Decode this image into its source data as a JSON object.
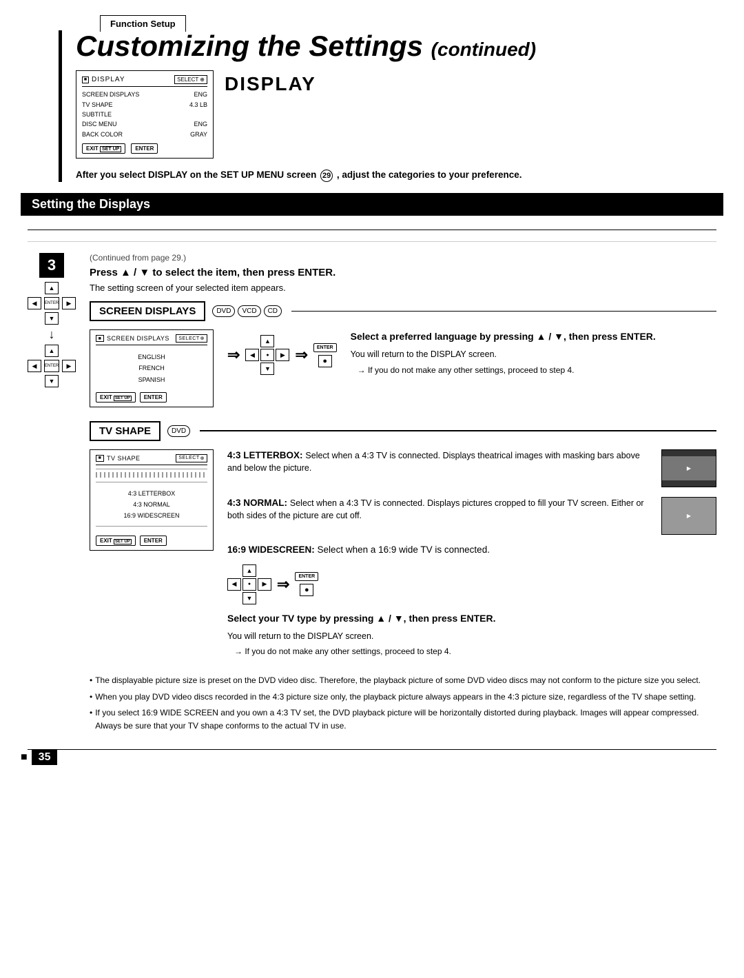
{
  "functionSetup": {
    "tab": "Function Setup"
  },
  "title": {
    "main": "Customizing the Settings",
    "continued": "(continued)"
  },
  "displayMenu": {
    "icon": "■",
    "label": "DISPLAY",
    "selectLabel": "SELECT",
    "rows": [
      {
        "left": "SCREEN DISPLAYS",
        "right": "ENG"
      },
      {
        "left": "TV SHAPE",
        "right": "4.3 LB"
      },
      {
        "left": "SUBTITLE",
        "right": ""
      },
      {
        "left": "DISC MENU",
        "right": "ENG"
      },
      {
        "left": "BACK COLOR",
        "right": "GRAY"
      }
    ],
    "exitBtn": "EXIT",
    "setupBtn": "SET UP",
    "enterBtn": "ENTER"
  },
  "displayHeading": "DISPLAY",
  "afterText": "After you select DISPLAY on the SET UP MENU screen",
  "screenNum": "29",
  "afterText2": ", adjust the categories to your preference.",
  "sectionHeader": "Setting the Displays",
  "step": {
    "number": "3",
    "continuedNote": "(Continued from page 29.)",
    "pressInstruction": "Press ▲ / ▼ to select the item, then press ENTER.",
    "settingScreenText": "The setting screen of your selected item appears."
  },
  "screenDisplays": {
    "title": "SCREEN DISPLAYS",
    "discBadges": [
      "DVD",
      "VCD",
      "CD"
    ],
    "menuItems": [
      "ENGLISH",
      "FRENCH",
      "SPANISH"
    ],
    "rightHeading": "Select a preferred language by pressing ▲ / ▼, then press ENTER.",
    "returnText": "You will return to the DISPLAY screen.",
    "proceedNote": "→ If you do not make any other settings, proceed to step 4."
  },
  "tvShape": {
    "title": "TV SHAPE",
    "discBadge": "DVD",
    "menuItems": [
      "4:3 LETTERBOX",
      "4:3 NORMAL",
      "16:9 WIDESCREEN"
    ],
    "options": [
      {
        "label": "4:3 LETTERBOX:",
        "desc": "Select when a 4:3 TV is connected. Displays theatrical images with masking bars above and below the picture.",
        "imgType": "letterbox"
      },
      {
        "label": "4:3 NORMAL:",
        "desc": "Select when a 4:3 TV is connected. Displays pictures cropped to fill your TV screen. Either or both sides of the picture are cut off.",
        "imgType": "normal"
      }
    ],
    "widescreenLabel": "16:9 WIDESCREEN:",
    "widescreenDesc": "Select when a 16:9 wide TV is connected.",
    "selectTVHeading": "Select your TV type by pressing ▲ / ▼, then press ENTER.",
    "returnText": "You will return to the DISPLAY screen.",
    "proceedNote": "→ If you do not make any other settings, proceed to step 4."
  },
  "notes": [
    "The displayable picture size is preset on the DVD video disc. Therefore, the playback picture of some DVD video discs may not conform to the picture size you select.",
    "When you play DVD video discs recorded in the 4:3 picture size only, the playback picture always appears in the 4:3 picture size, regardless of the TV shape setting.",
    "If you select 16:9 WIDE SCREEN and you own a 4:3 TV set, the DVD playback picture will be horizontally distorted during playback. Images will appear compressed. Always be sure that your TV shape conforms to the actual TV in use."
  ],
  "pageNumber": "35"
}
